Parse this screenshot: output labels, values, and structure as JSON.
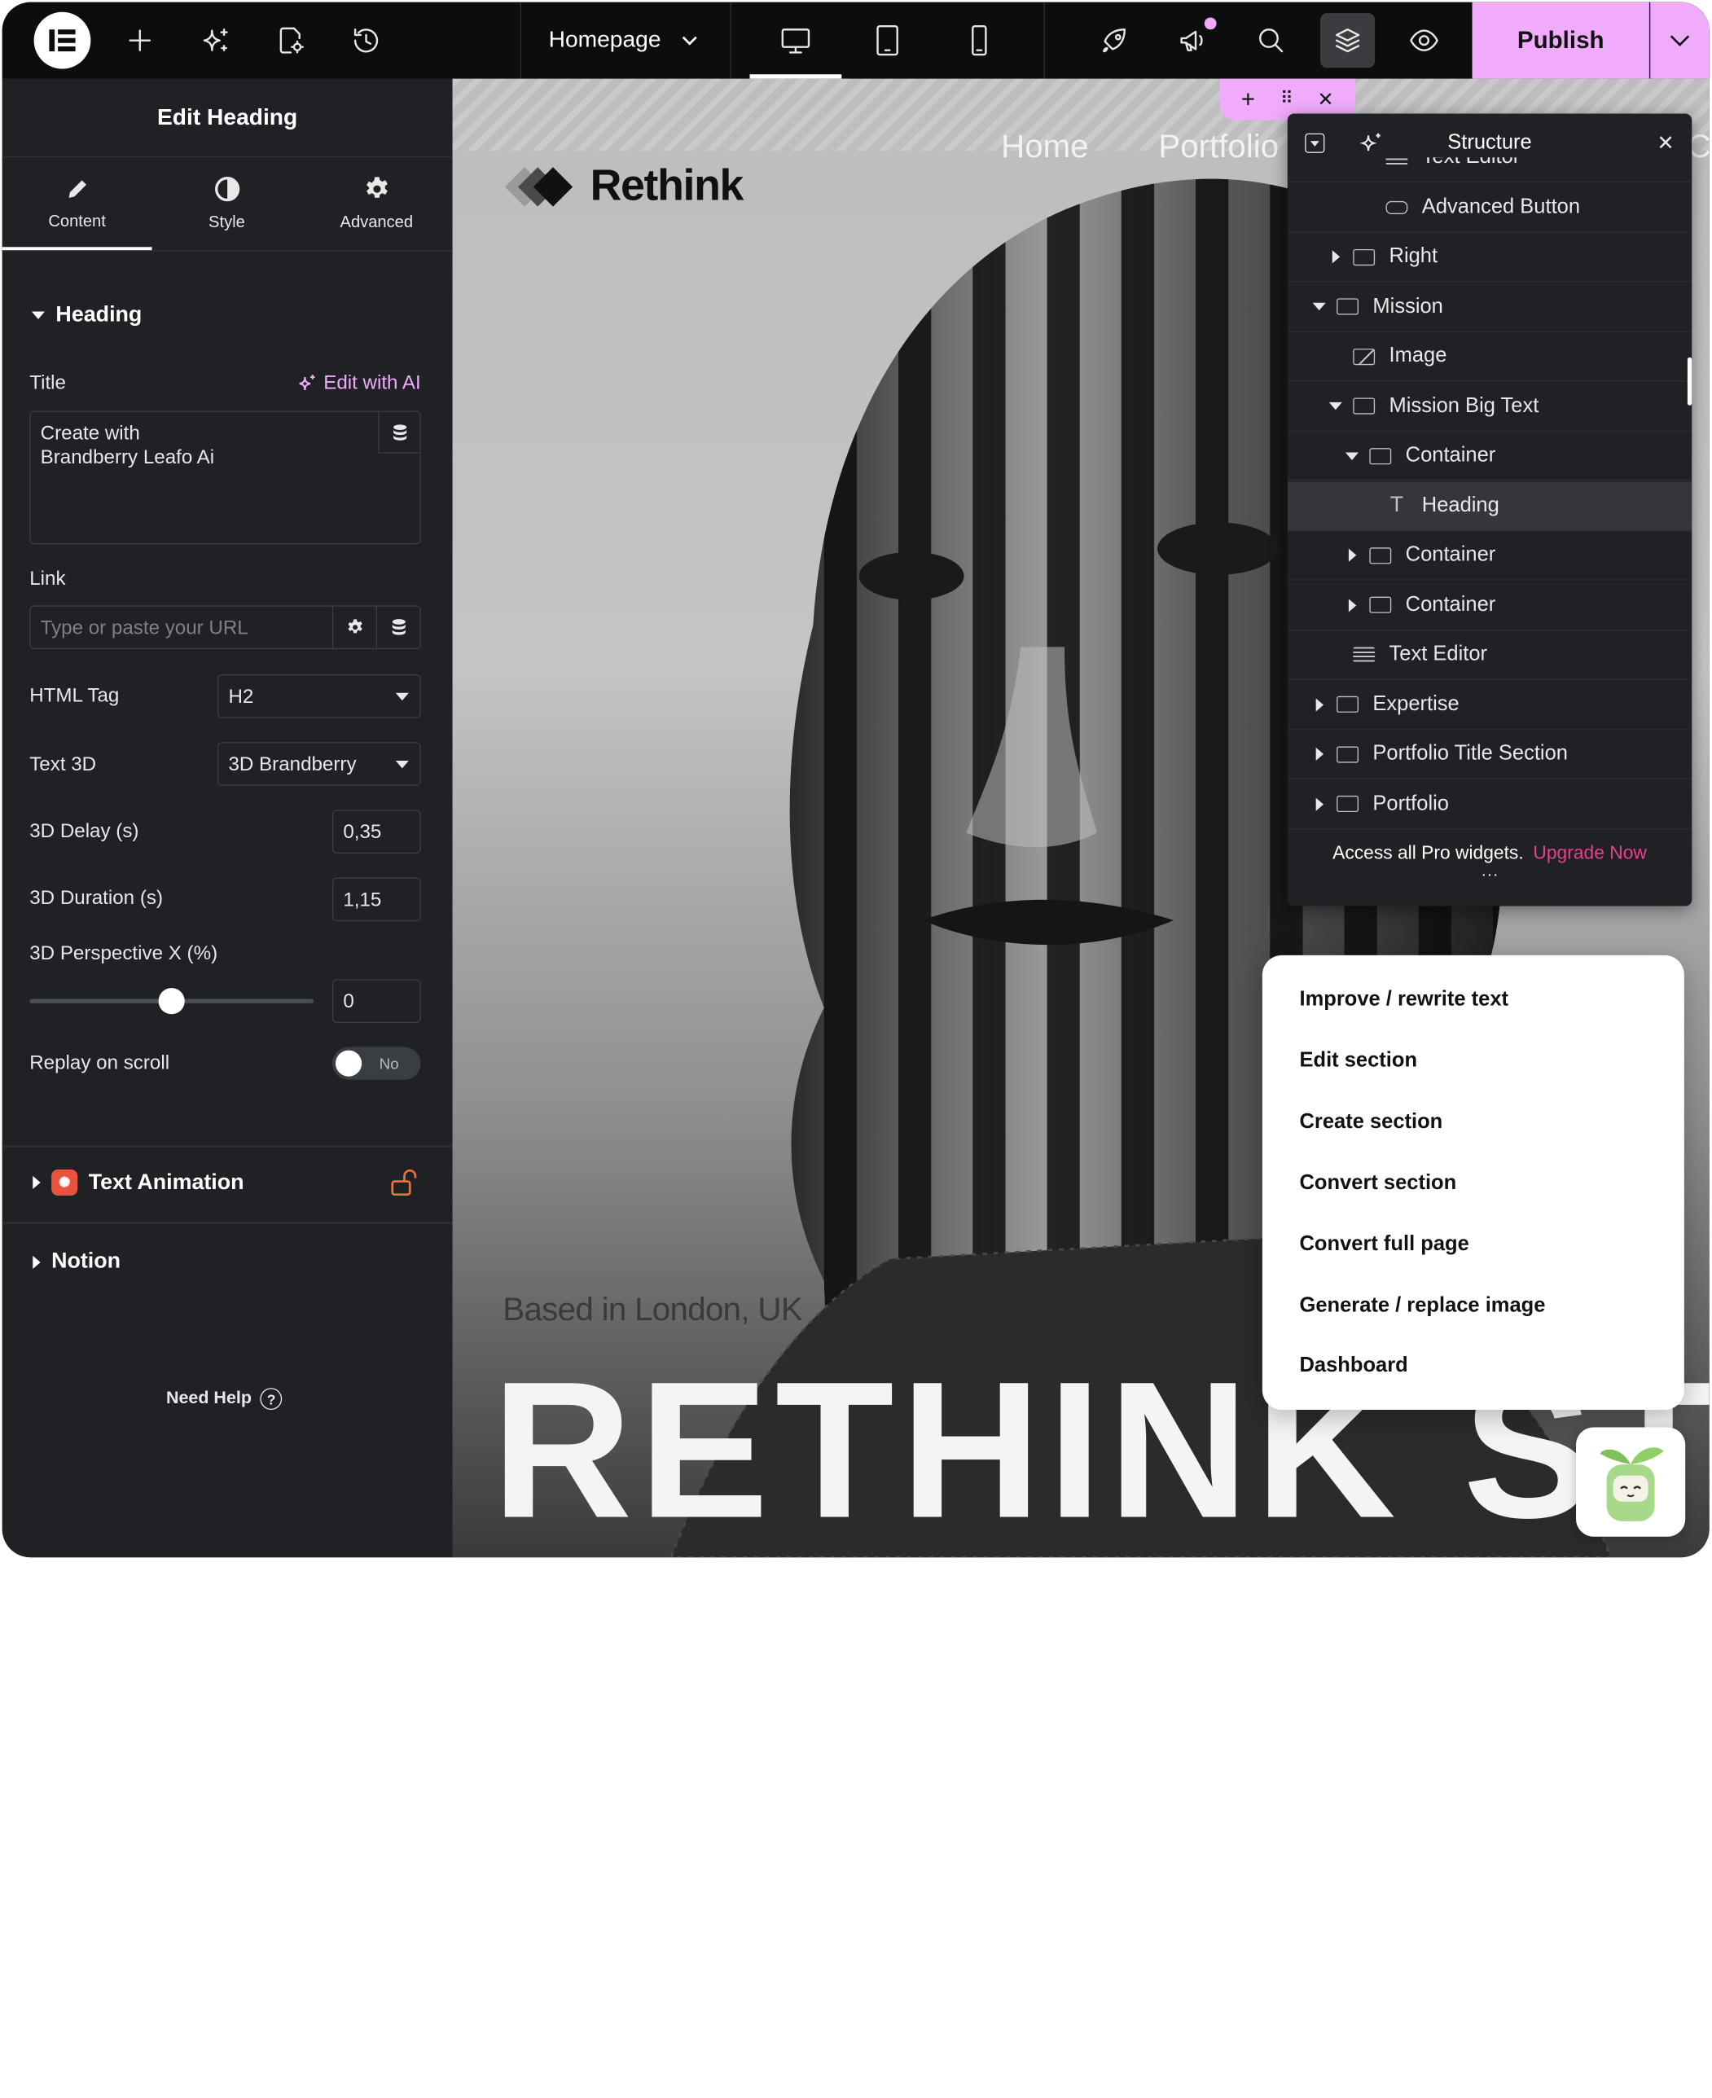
{
  "topbar": {
    "page_name": "Homepage",
    "publish_label": "Publish",
    "devices": [
      "desktop",
      "tablet",
      "mobile"
    ],
    "icons": [
      "elementor-logo-icon",
      "plus-icon",
      "ai-sparkle-icon",
      "page-settings-icon",
      "history-icon",
      "rocket-icon",
      "announcement-icon",
      "search-icon",
      "layers-icon",
      "preview-eye-icon"
    ]
  },
  "panel": {
    "title": "Edit Heading",
    "tabs": [
      {
        "label": "Content",
        "icon": "pencil-icon"
      },
      {
        "label": "Style",
        "icon": "half-circle-icon"
      },
      {
        "label": "Advanced",
        "icon": "gear-icon"
      }
    ],
    "section_heading": "Heading",
    "title_label": "Title",
    "edit_ai_label": "Edit with AI",
    "title_value": "Create with\nBrandberry Leafo Ai",
    "link_label": "Link",
    "link_placeholder": "Type or paste your URL",
    "html_tag_label": "HTML Tag",
    "html_tag_value": "H2",
    "text3d_label": "Text 3D",
    "text3d_value": "3D Brandberry",
    "delay_label": "3D Delay (s)",
    "delay_value": "0,35",
    "duration_label": "3D Duration (s)",
    "duration_value": "1,15",
    "perspective_label": "3D Perspective X (%)",
    "perspective_value": "0",
    "replay_label": "Replay on scroll",
    "replay_value": "No",
    "text_animation_label": "Text Animation",
    "notion_label": "Notion",
    "need_help_label": "Need Help"
  },
  "canvas": {
    "brand": "Rethink",
    "nav": [
      "Home",
      "Portfolio",
      "Co"
    ],
    "based": "Based in London, UK",
    "big_word": "RETHINK STU"
  },
  "structure": {
    "title": "Structure",
    "items": [
      {
        "label": "Text Editor",
        "depth": 4,
        "icon": "text-editor-icon",
        "toggle": "none"
      },
      {
        "label": "Advanced Button",
        "depth": 4,
        "icon": "button-icon",
        "toggle": "none"
      },
      {
        "label": "Right",
        "depth": 2,
        "icon": "container-icon",
        "toggle": "collapsed"
      },
      {
        "label": "Mission",
        "depth": 1,
        "icon": "container-icon",
        "toggle": "expanded"
      },
      {
        "label": "Image",
        "depth": 2,
        "icon": "image-icon",
        "toggle": "none"
      },
      {
        "label": "Mission Big Text",
        "depth": 2,
        "icon": "container-icon",
        "toggle": "expanded"
      },
      {
        "label": "Container",
        "depth": 3,
        "icon": "container-icon",
        "toggle": "expanded"
      },
      {
        "label": "Heading",
        "depth": 4,
        "icon": "heading-icon",
        "toggle": "none",
        "selected": true
      },
      {
        "label": "Container",
        "depth": 3,
        "icon": "container-icon",
        "toggle": "collapsed"
      },
      {
        "label": "Container",
        "depth": 3,
        "icon": "container-icon",
        "toggle": "collapsed"
      },
      {
        "label": "Text Editor",
        "depth": 2,
        "icon": "text-editor-icon",
        "toggle": "none"
      },
      {
        "label": "Expertise",
        "depth": 1,
        "icon": "container-icon",
        "toggle": "collapsed"
      },
      {
        "label": "Portfolio Title Section",
        "depth": 1,
        "icon": "container-icon",
        "toggle": "collapsed"
      },
      {
        "label": "Portfolio",
        "depth": 1,
        "icon": "container-icon",
        "toggle": "collapsed"
      }
    ],
    "footer_text": "Access all Pro widgets.",
    "upgrade_label": "Upgrade Now"
  },
  "ai_menu": {
    "items": [
      "Improve / rewrite text",
      "Edit section",
      "Create section",
      "Convert section",
      "Convert full page",
      "Generate / replace image",
      "Dashboard"
    ]
  },
  "colors": {
    "accent": "#f0abfc",
    "panel_bg": "#1f2124",
    "topbar_bg": "#0c0d0e",
    "ai_accent": "#f0abfc",
    "upgrade_link": "#e5418f",
    "notification_dot": "#f0abfc"
  }
}
